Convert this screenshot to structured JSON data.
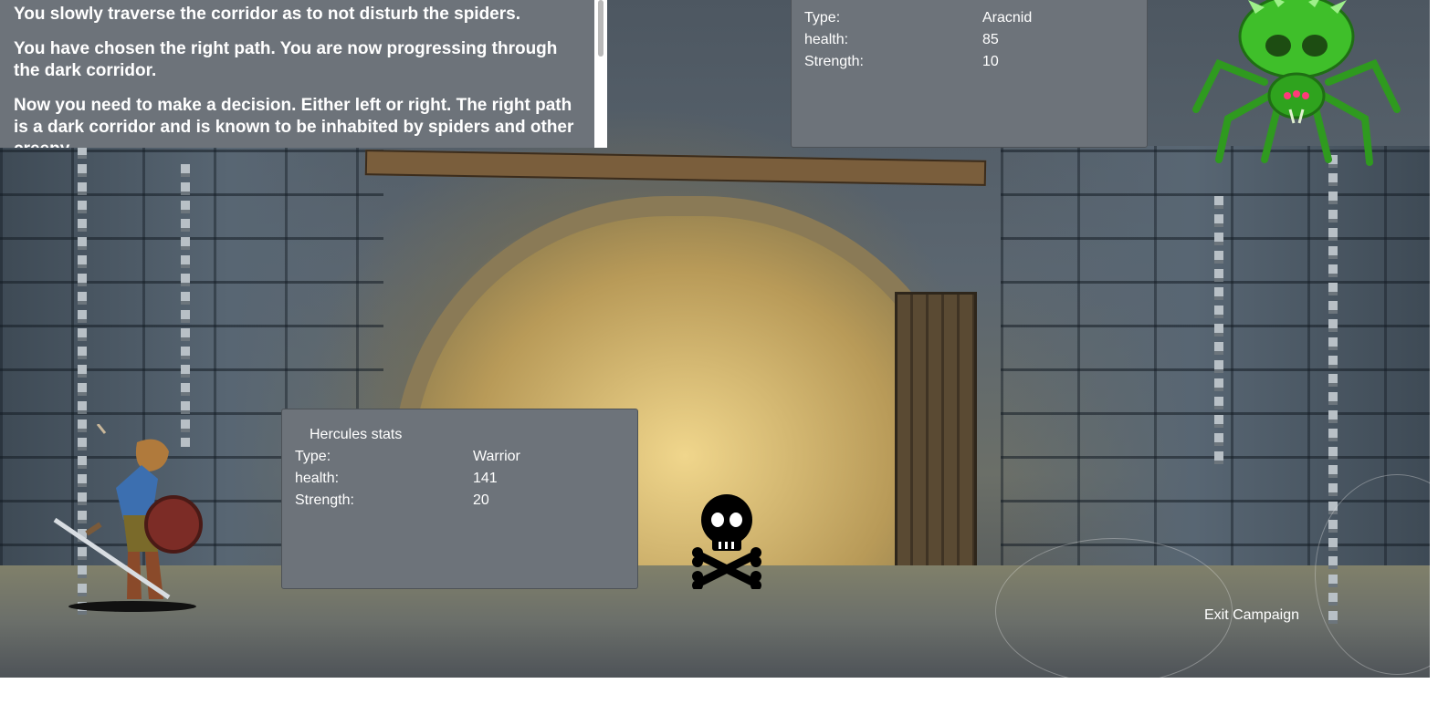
{
  "story": {
    "paragraphs": [
      "You slowly traverse the corridor as to not disturb the spiders.",
      "You have chosen the right path. You are now progressing through the dark corridor.",
      "Now you need to make a decision. Either left or right. The right path is a dark corridor and is known to be inhabited by spiders and other creepy"
    ]
  },
  "enemy": {
    "rows": [
      {
        "label": "Type:",
        "value": "Aracnid"
      },
      {
        "label": "health:",
        "value": "85"
      },
      {
        "label": "Strength:",
        "value": "10"
      }
    ]
  },
  "hero": {
    "title": "Hercules stats",
    "rows": [
      {
        "label": "Type:",
        "value": "Warrior"
      },
      {
        "label": "health:",
        "value": "141"
      },
      {
        "label": "Strength:",
        "value": "20"
      }
    ]
  },
  "actions": {
    "exit_label": "Exit Campaign"
  },
  "icons": {
    "defeat": "skull-and-crossbones-icon",
    "enemy_sprite": "green-spider-sprite",
    "hero_sprite": "warrior-hero-sprite"
  },
  "colors": {
    "panel_bg": "#6d737a",
    "panel_text": "#ffffff",
    "spider_green": "#3fbf2a"
  }
}
